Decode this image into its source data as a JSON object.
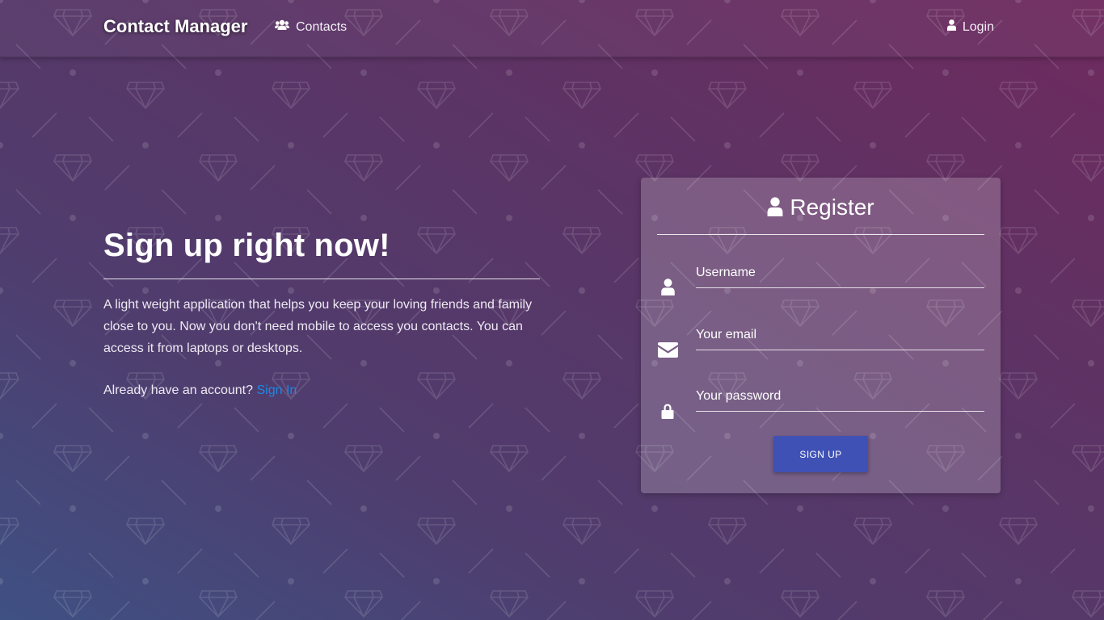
{
  "navbar": {
    "brand": "Contact Manager",
    "contacts_label": "Contacts",
    "login_label": "Login"
  },
  "hero": {
    "heading": "Sign up right now!",
    "description": "A light weight application that helps you keep your loving friends and family close to you. Now you don't need mobile to access you contacts. You can access it from laptops or desktops.",
    "account_prompt": "Already have an account?",
    "signin_label": "Sign In"
  },
  "register": {
    "title": "Register",
    "username_placeholder": "Username",
    "username_value": "",
    "email_placeholder": "Your email",
    "email_value": "",
    "password_placeholder": "Your password",
    "password_value": "",
    "submit_label": "SIGN UP"
  },
  "colors": {
    "link": "#1e88e5",
    "button": "#3f51b5"
  },
  "icons": {
    "contacts": "users-icon",
    "login": "user-icon",
    "register": "user-icon",
    "username": "user-icon",
    "email": "envelope-icon",
    "password": "lock-icon"
  }
}
